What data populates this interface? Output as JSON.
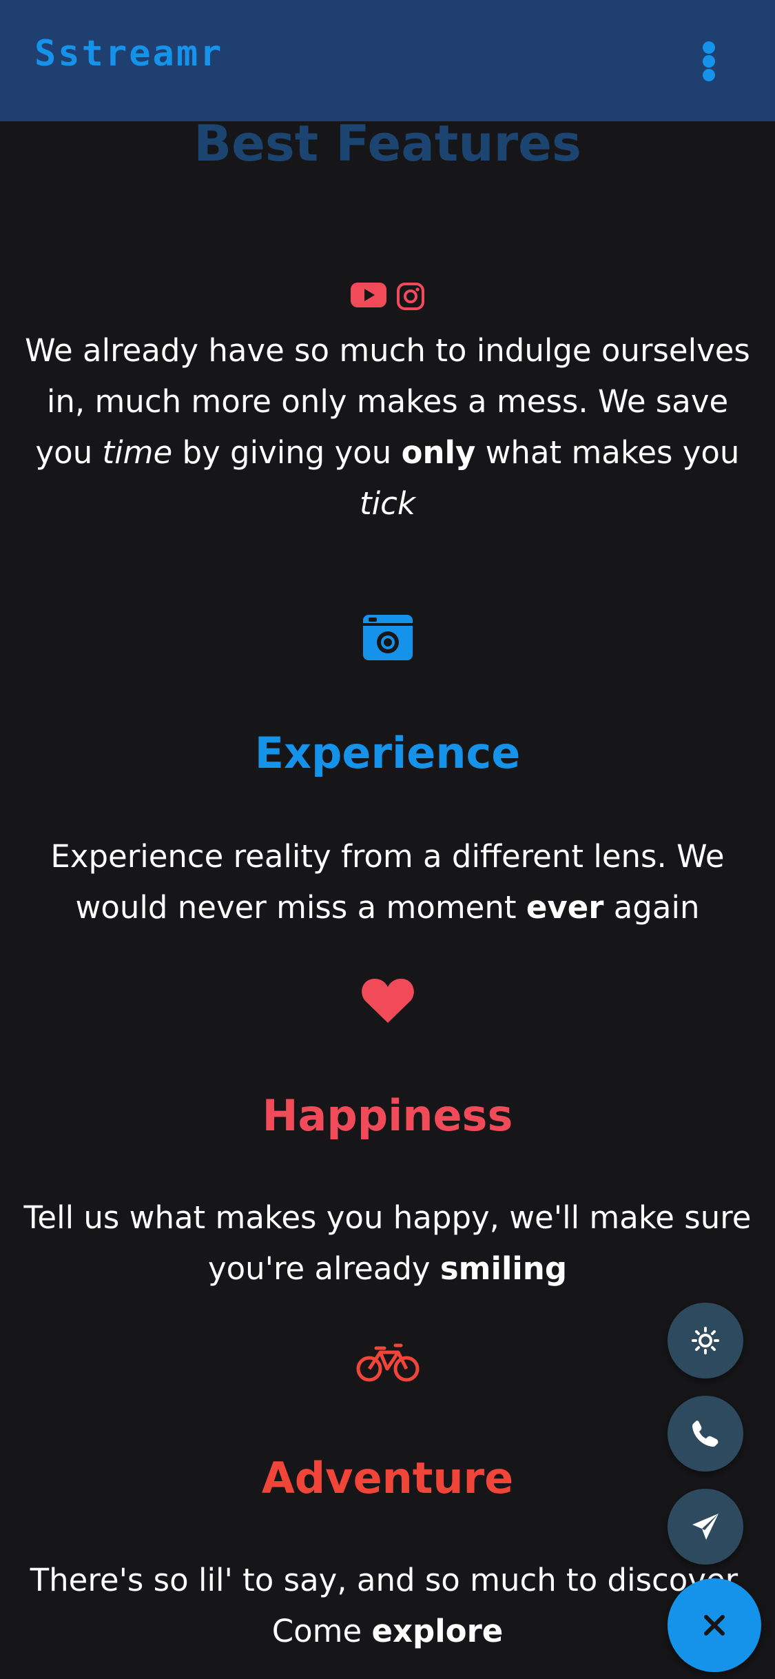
{
  "navbar": {
    "brand": "Sstreamr",
    "menu_icon": "more-vertical-icon"
  },
  "section": {
    "title": "Best Features"
  },
  "intro": {
    "icons": [
      "youtube-icon",
      "instagram-icon"
    ],
    "part1": "We already have so much to indulge ourselves in, much more only makes a mess. We save you ",
    "em1": "time",
    "part2": " by giving you ",
    "strong1": "only",
    "part3": " what makes you ",
    "em2": "tick"
  },
  "features": [
    {
      "icon": "camera-icon",
      "title": "Experience",
      "color": "#1593ea",
      "text_before": "Experience reality from a different lens. We would never miss a moment ",
      "strong": "ever",
      "text_after": " again"
    },
    {
      "icon": "heart-icon",
      "title": "Happiness",
      "color": "#f14b5a",
      "text_before": "Tell us what makes you happy, we'll make sure you're already ",
      "strong": "smiling",
      "text_after": ""
    },
    {
      "icon": "bicycle-icon",
      "title": "Adventure",
      "color": "#f2453a",
      "text_before": "There's so lil' to say, and so much to discover. Come ",
      "strong": "explore",
      "text_after": ""
    }
  ],
  "fab": {
    "items": [
      "sun-icon",
      "phone-icon",
      "send-icon"
    ],
    "main_icon": "close-icon",
    "item_color": "#2e4a5e",
    "main_color": "#1593ea"
  },
  "colors": {
    "navbar": "#1e3f6f",
    "brand": "#1593ea",
    "background": "#161618",
    "title": "#1b4471"
  }
}
